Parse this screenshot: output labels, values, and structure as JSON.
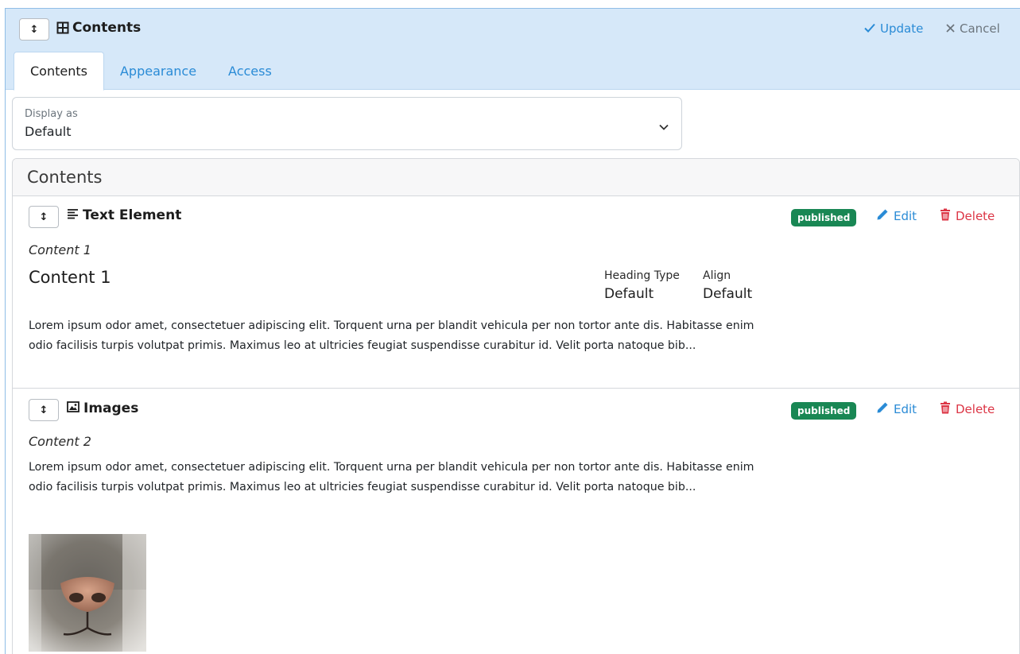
{
  "header": {
    "drag_glyph": "↕",
    "title": "Contents",
    "title_icon": "table-grid-icon",
    "update_label": "Update",
    "cancel_label": "Cancel"
  },
  "tabs": [
    {
      "label": "Contents",
      "active": true
    },
    {
      "label": "Appearance",
      "active": false
    },
    {
      "label": "Access",
      "active": false
    }
  ],
  "display_select": {
    "label": "Display as",
    "value": "Default"
  },
  "contents_section": {
    "title": "Contents",
    "items": [
      {
        "type_label": "Text Element",
        "type_icon": "text-align-icon",
        "status": "published",
        "edit_label": "Edit",
        "delete_label": "Delete",
        "subtitle": "Content 1",
        "heading": "Content 1",
        "meta": [
          {
            "label": "Heading Type",
            "value": "Default"
          },
          {
            "label": "Align",
            "value": "Default"
          }
        ],
        "body": "Lorem ipsum odor amet, consectetuer adipiscing elit. Torquent urna per blandit vehicula per non tortor ante dis. Habitasse enim odio facilisis turpis volutpat primis. Maximus leo at ultricies feugiat suspendisse curabitur id. Velit porta natoque bib..."
      },
      {
        "type_label": "Images",
        "type_icon": "image-icon",
        "status": "published",
        "edit_label": "Edit",
        "delete_label": "Delete",
        "subtitle": "Content 2",
        "body": "Lorem ipsum odor amet, consectetuer adipiscing elit. Torquent urna per blandit vehicula per non tortor ante dis. Habitasse enim odio facilisis turpis volutpat primis. Maximus leo at ultricies feugiat suspendisse curabitur id. Velit porta natoque bib...",
        "thumbnail": "cat-nose-photo"
      }
    ]
  },
  "colors": {
    "header_bg": "#d6e8f9",
    "link_blue": "#2a8bd6",
    "published_green": "#198754",
    "delete_red": "#dc3545"
  }
}
